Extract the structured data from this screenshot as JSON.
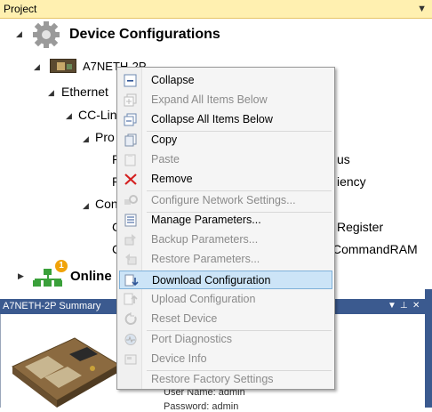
{
  "project_panel": {
    "title": "Project"
  },
  "tree": {
    "root": "Device Configurations",
    "device": "A7NETH-2P",
    "ethernet": "Ethernet",
    "cclink": "CC-Lin",
    "pro": "Pro",
    "p1": "P",
    "p1_tail": "us",
    "p2": "P",
    "p2_tail": "iency",
    "con": "Con",
    "c1": "C",
    "c1_tail": "Register",
    "c2": "C",
    "c2_tail": "CommandRAM",
    "online": "Online",
    "online_badge": "1"
  },
  "summary_panel": {
    "title": "A7NETH-2P Summary",
    "user_name": "User Name: admin",
    "password": "Password: admin"
  },
  "context_menu": {
    "items": [
      {
        "label": "Collapse",
        "enabled": true,
        "icon": "collapse-icon"
      },
      {
        "label": "Expand All Items Below",
        "enabled": false,
        "icon": "expand-all-icon"
      },
      {
        "label": "Collapse All Items Below",
        "enabled": true,
        "icon": "collapse-all-icon"
      },
      {
        "label": "Copy",
        "enabled": true,
        "icon": "copy-icon"
      },
      {
        "label": "Paste",
        "enabled": false,
        "icon": "paste-icon"
      },
      {
        "label": "Remove",
        "enabled": true,
        "icon": "remove-icon"
      },
      {
        "label": "Configure Network Settings...",
        "enabled": false,
        "icon": "network-settings-icon"
      },
      {
        "label": "Manage Parameters...",
        "enabled": true,
        "icon": "manage-parameters-icon"
      },
      {
        "label": "Backup Parameters...",
        "enabled": false,
        "icon": "backup-icon"
      },
      {
        "label": "Restore Parameters...",
        "enabled": false,
        "icon": "restore-icon"
      },
      {
        "label": "Download Configuration",
        "enabled": true,
        "highlighted": true,
        "icon": "download-icon"
      },
      {
        "label": "Upload Configuration",
        "enabled": false,
        "icon": "upload-icon"
      },
      {
        "label": "Reset Device",
        "enabled": false,
        "icon": "reset-icon"
      },
      {
        "label": "Port Diagnostics",
        "enabled": false,
        "icon": "port-diagnostics-icon"
      },
      {
        "label": "Device Info",
        "enabled": false,
        "icon": "device-info-icon"
      },
      {
        "label": "Restore Factory Settings",
        "enabled": false,
        "icon": "factory-settings-icon"
      }
    ]
  },
  "colors": {
    "project_bar": "#fff0b0",
    "summary_bar": "#3b5a8f",
    "menu_highlight": "#cce4f7",
    "remove_red": "#d42020"
  }
}
